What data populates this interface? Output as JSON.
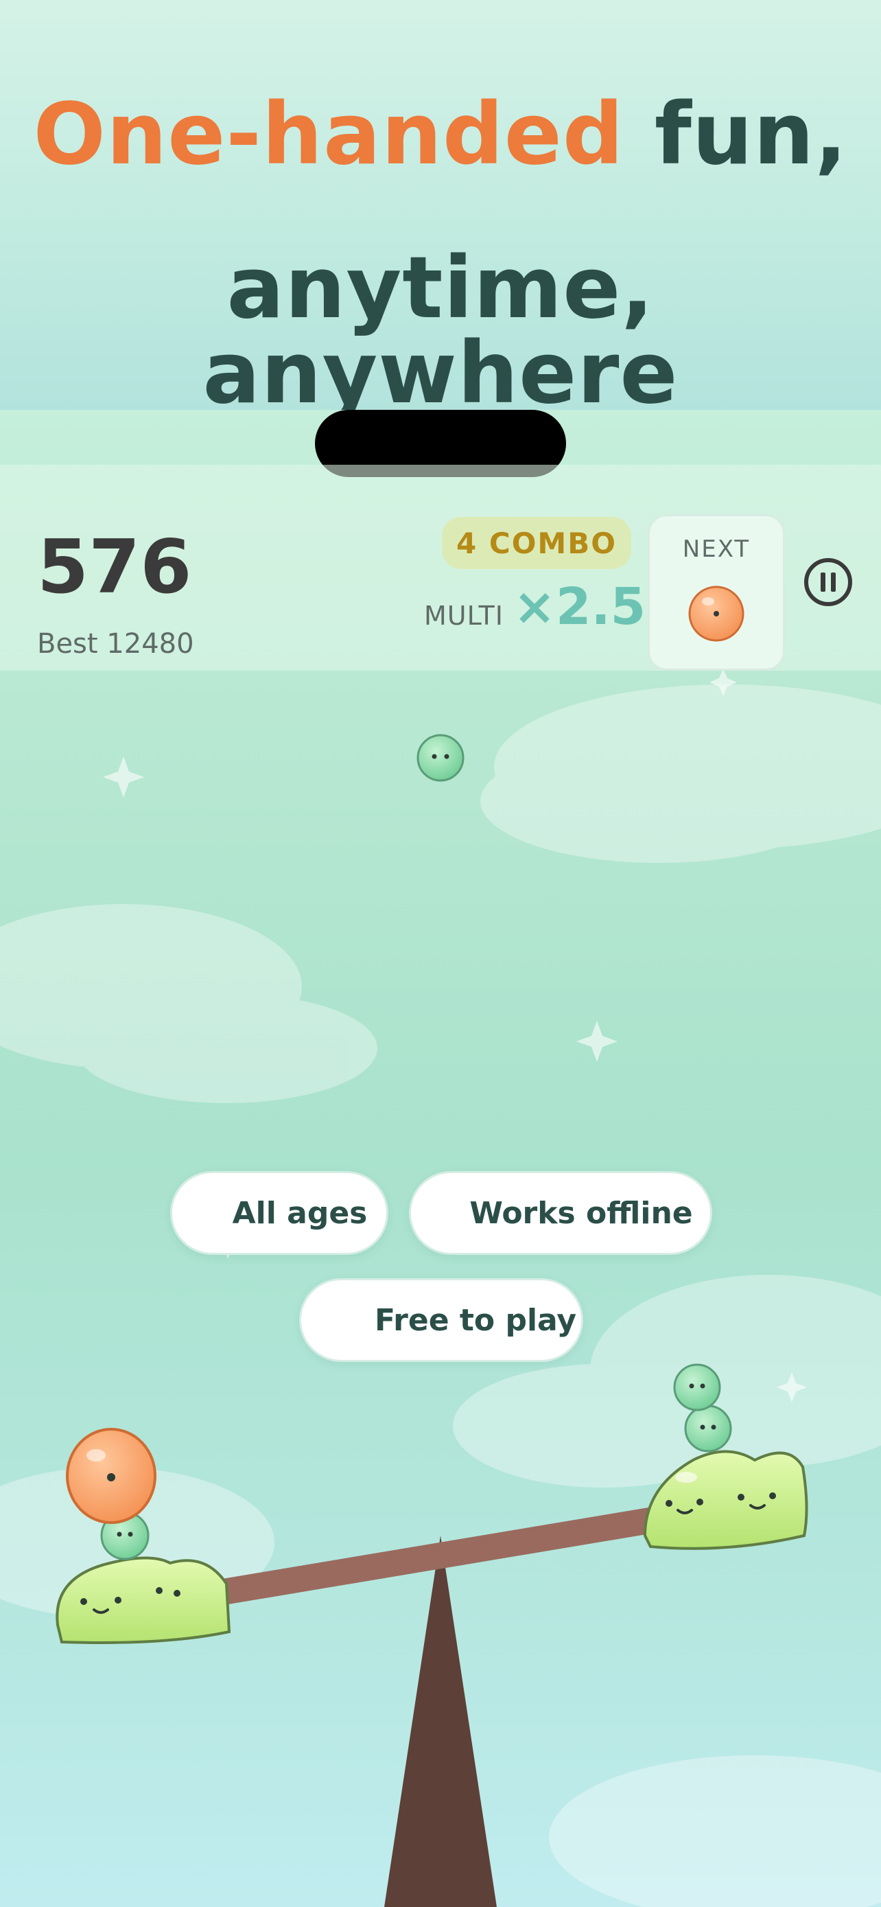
{
  "promo": {
    "headline_accent": "One-handed",
    "headline_rest": " fun,",
    "headline_line2": "anytime, anywhere"
  },
  "hud": {
    "score": "576",
    "best": "Best 12480",
    "combo": "4 COMBO",
    "multi_label": "MULTI",
    "multi_value": "×2.5",
    "next_label": "NEXT",
    "next_piece_icon": "orange-slime-icon",
    "pause_icon": "pause-icon"
  },
  "features": {
    "all_ages": "All ages",
    "works_offline": "Works offline",
    "free_to_play": "Free to play"
  },
  "colors": {
    "accent": "#ec7b3c",
    "headline": "#2b4f48",
    "multi": "#6cc3b4",
    "combo_text": "#b58a17",
    "slime_green": "#7fd6a2",
    "slime_lime": "#c6ee82",
    "slime_orange": "#f9a46c",
    "beam": "#9a6a5f",
    "fulcrum": "#5d4038"
  }
}
